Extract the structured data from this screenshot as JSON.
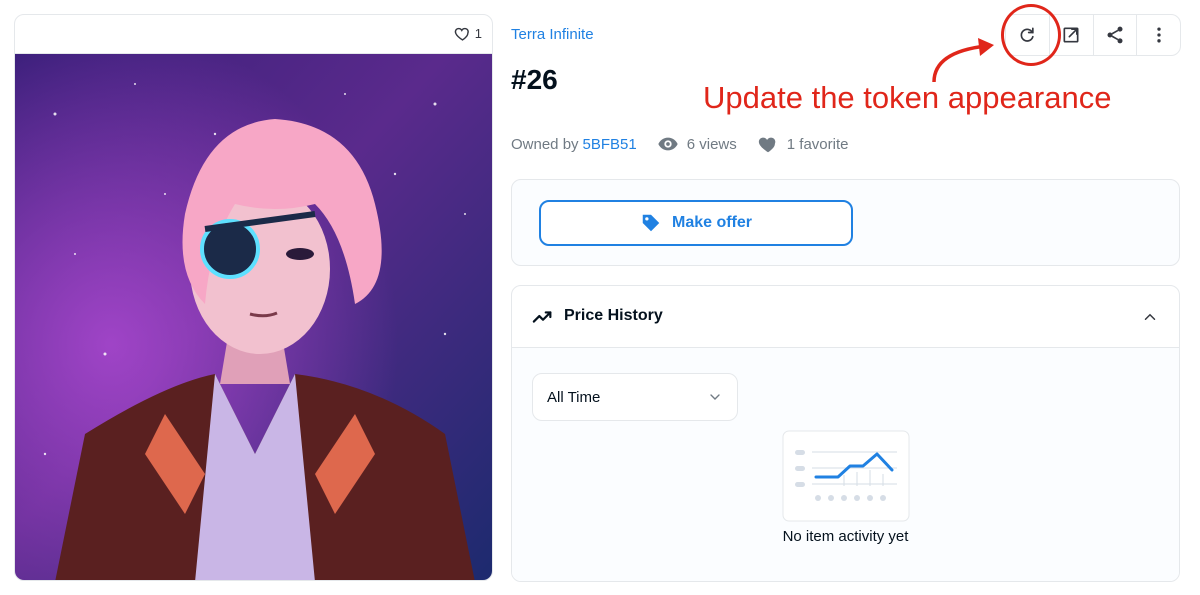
{
  "image_card": {
    "favorite_count": "1"
  },
  "asset": {
    "collection_name": "Terra Infinite",
    "token_title": "#26",
    "owned_by_label": "Owned by",
    "owner_name": "5BFB51",
    "views_text": "6 views",
    "favorites_text": "1 favorite"
  },
  "toolbar": {
    "buttons": [
      "refresh-icon",
      "external-link-icon",
      "share-icon",
      "more-vertical-icon"
    ]
  },
  "annotation": {
    "text": "Update the token appearance",
    "color": "#e0261a"
  },
  "offer": {
    "make_offer_label": "Make offer"
  },
  "price_history": {
    "title": "Price History",
    "range_selected": "All Time",
    "empty_text": "No item activity yet"
  },
  "colors": {
    "accent": "#2081e2",
    "border": "#e5e8eb",
    "text": "#04111d",
    "muted": "#707a83"
  }
}
